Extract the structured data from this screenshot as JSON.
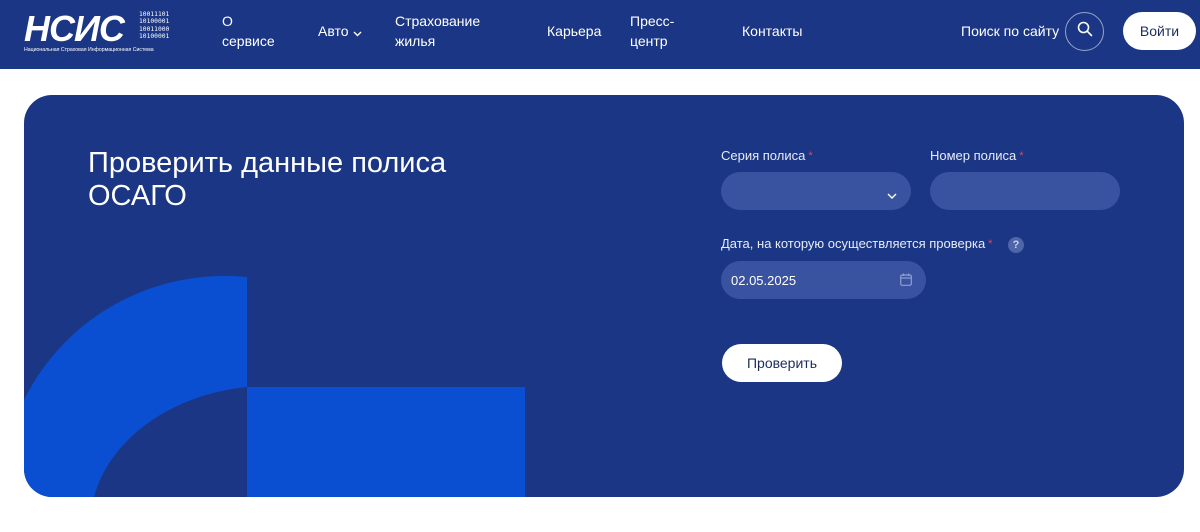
{
  "header": {
    "logo": {
      "main": "НСИС",
      "bits": "10011101\n10100001\n10011000\n10100001",
      "subtitle": "Национальная Страховая Информационная Система"
    },
    "nav": [
      {
        "line1": "О",
        "line2": "сервисе"
      },
      {
        "label": "Авто"
      },
      {
        "line1": "Страхование",
        "line2": "жилья"
      },
      {
        "label": "Карьера"
      },
      {
        "line1": "Пресс-",
        "line2": "центр"
      },
      {
        "label": "Контакты"
      }
    ],
    "search_label": "Поиск по сайту",
    "login_label": "Войти"
  },
  "form": {
    "title": "Проверить данные полиса ОСАГО",
    "series_label": "Серия полиса",
    "number_label": "Номер полиса",
    "date_label": "Дата, на которую осуществляется проверка",
    "required_mark": "*",
    "help_mark": "?",
    "series_value": "",
    "number_value": "",
    "date_value": "02.05.2025",
    "submit_label": "Проверить"
  },
  "colors": {
    "brand_navy": "#1b3685",
    "field_bg": "#3a53a0",
    "accent_blue": "#0a4fd1",
    "required": "#e8435a"
  },
  "icons": [
    "search-icon",
    "chevron-down-icon",
    "calendar-icon",
    "help-icon"
  ]
}
